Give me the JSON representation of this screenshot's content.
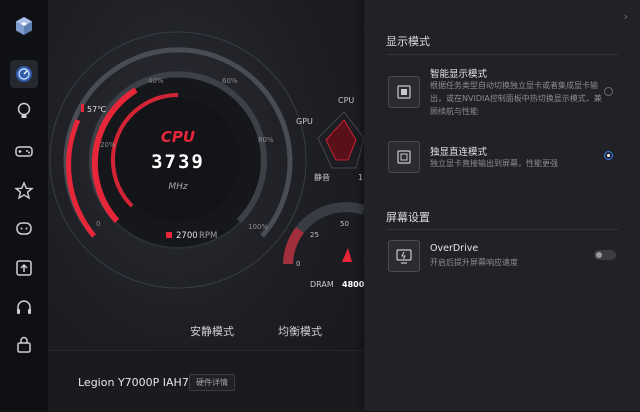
{
  "colors": {
    "accent_red": "#e8263a",
    "accent_blue": "#3b7ff5",
    "panel_bg": "#212227"
  },
  "sidebar": {
    "items": [
      {
        "icon": "cube-logo-icon"
      },
      {
        "icon": "dashboard-icon",
        "active": true
      },
      {
        "icon": "lightbulb-icon"
      },
      {
        "icon": "gamepad-icon"
      },
      {
        "icon": "star-icon"
      },
      {
        "icon": "chat-icon"
      },
      {
        "icon": "upload-icon"
      },
      {
        "icon": "headphones-icon"
      },
      {
        "icon": "lock-icon"
      }
    ]
  },
  "gauge": {
    "label": "CPU",
    "value": "3739",
    "unit": "MHz",
    "temperature": "57℃",
    "fan_speed": "2700",
    "fan_unit": "RPM",
    "ticks": [
      "0",
      "20%",
      "40%",
      "60%",
      "80%",
      "100%"
    ]
  },
  "radar": {
    "labels": [
      "CPU",
      "GPU",
      "静音"
    ],
    "right_label": "1"
  },
  "dram": {
    "label": "DRAM",
    "value": "4800",
    "ticks": [
      "0",
      "25",
      "50"
    ]
  },
  "modes": {
    "quiet": "安静模式",
    "balanced": "均衡模式"
  },
  "footer": {
    "device": "Legion Y7000P IAH7",
    "hw_button": "硬件详情"
  },
  "panel": {
    "display_mode_title": "显示模式",
    "smart_mode": {
      "title": "智能显示模式",
      "desc": "根据任务类型自动切换独立显卡或者集成显卡输出，或在NVIDIA控制面板中热切换显示模式，兼顾续航与性能",
      "selected": false
    },
    "direct_mode": {
      "title": "独显直连模式",
      "desc": "独立显卡直接输出到屏幕，性能更强",
      "selected": true
    },
    "screen_settings_title": "屏幕设置",
    "overdrive": {
      "title": "OverDrive",
      "desc": "开启后提升屏幕响应速度",
      "enabled": false
    }
  }
}
